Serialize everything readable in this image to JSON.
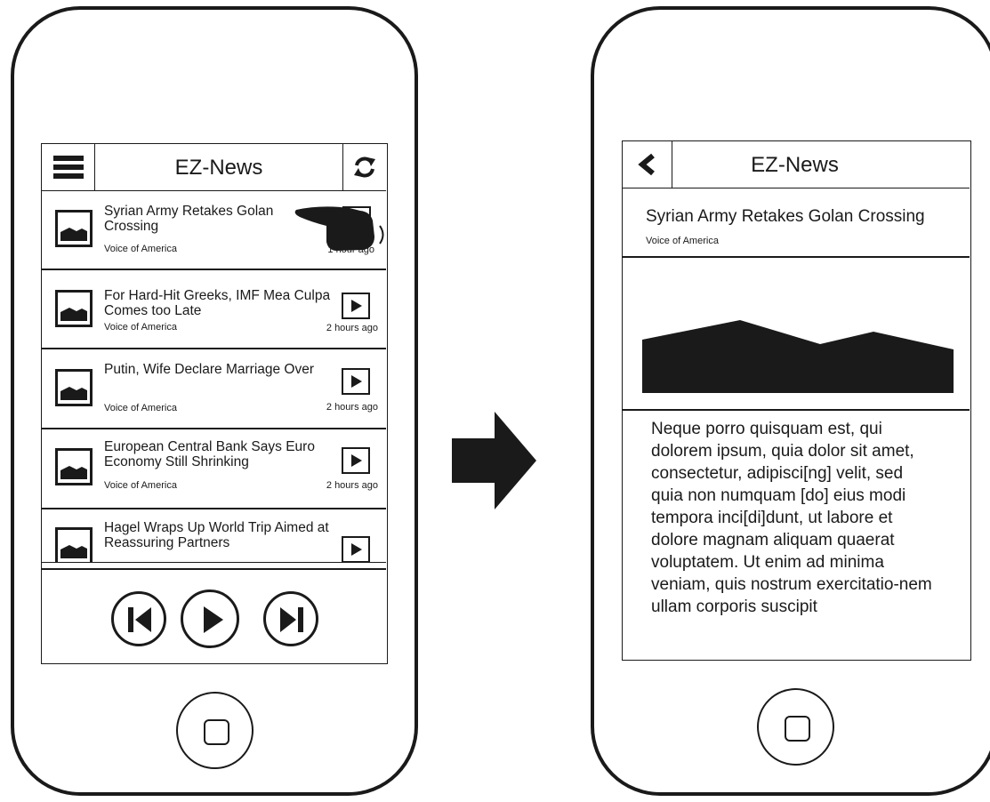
{
  "list_screen": {
    "app_title": "EZ-News",
    "items": [
      {
        "title": "Syrian Army Retakes Golan Crossing",
        "source": "Voice of America",
        "time": "1 hour ago"
      },
      {
        "title": "For Hard-Hit Greeks, IMF Mea Culpa Comes too Late",
        "source": "Voice of America",
        "time": "2 hours ago"
      },
      {
        "title": "Putin, Wife Declare Marriage Over",
        "source": "Voice of America",
        "time": "2 hours ago"
      },
      {
        "title": "European Central Bank Says Euro Economy Still Shrinking",
        "source": "Voice of America",
        "time": "2 hours ago"
      },
      {
        "title": "Hagel Wraps Up World Trip Aimed at Reassuring Partners",
        "source": "",
        "time": ""
      }
    ]
  },
  "detail_screen": {
    "app_title": "EZ-News",
    "article_title": "Syrian Army Retakes Golan Crossing",
    "source": "Voice of America",
    "body": "Neque porro quisquam est, qui dolorem ipsum, quia dolor sit amet, consectetur, adipisci[ng] velit, sed quia non numquam [do] eius modi tempora inci[di]dunt, ut labore et dolore magnam aliquam quaerat voluptatem. Ut enim ad minima veniam, quis nostrum exercitatio-nem ullam corporis suscipit"
  },
  "icons": {
    "menu": "hamburger-icon",
    "refresh": "refresh-icon",
    "back": "chevron-left-icon",
    "play": "play-icon",
    "previous": "skip-previous-icon",
    "next": "skip-next-icon",
    "image": "image-placeholder-icon",
    "swipe": "hand-swipe-icon",
    "transition": "arrow-right-icon"
  },
  "colors": {
    "ink": "#1a1a1a",
    "background": "#ffffff"
  }
}
